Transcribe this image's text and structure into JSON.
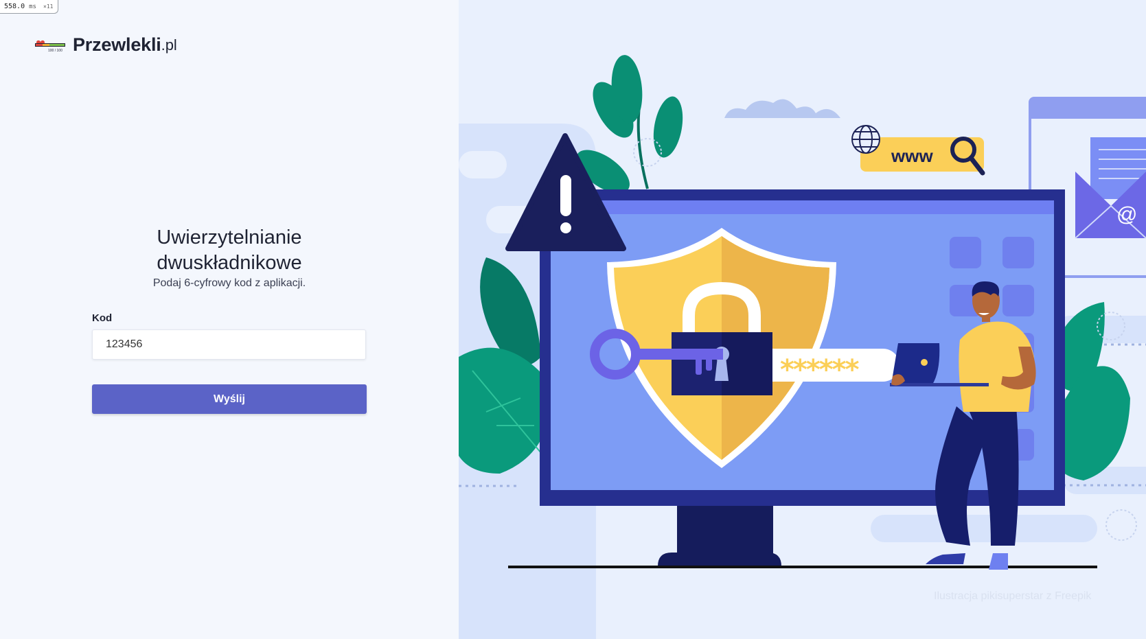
{
  "perf": {
    "value": "558.0",
    "unit": "ms",
    "multiplier": "×11"
  },
  "brand": {
    "name": "Przewlekli",
    "tld": ".pl",
    "logo_caption": "100 / 100"
  },
  "auth": {
    "title": "Uwierzytelnianie dwuskładnikowe",
    "subtitle": "Podaj 6-cyfrowy kod z aplikacji.",
    "code_label": "Kod",
    "code_value": "123456",
    "submit_label": "Wyślij"
  },
  "illustration": {
    "www_label": "www",
    "password_mask": "******",
    "email_symbol": "@",
    "credit": "Ilustracja pikisuperstar z Freepik"
  },
  "colors": {
    "accent": "#5b63c7",
    "left_background": "#f4f7fd",
    "right_background": "#e9f0fd",
    "shield_yellow": "#fbcf58",
    "monitor_frame": "#262f8f"
  }
}
